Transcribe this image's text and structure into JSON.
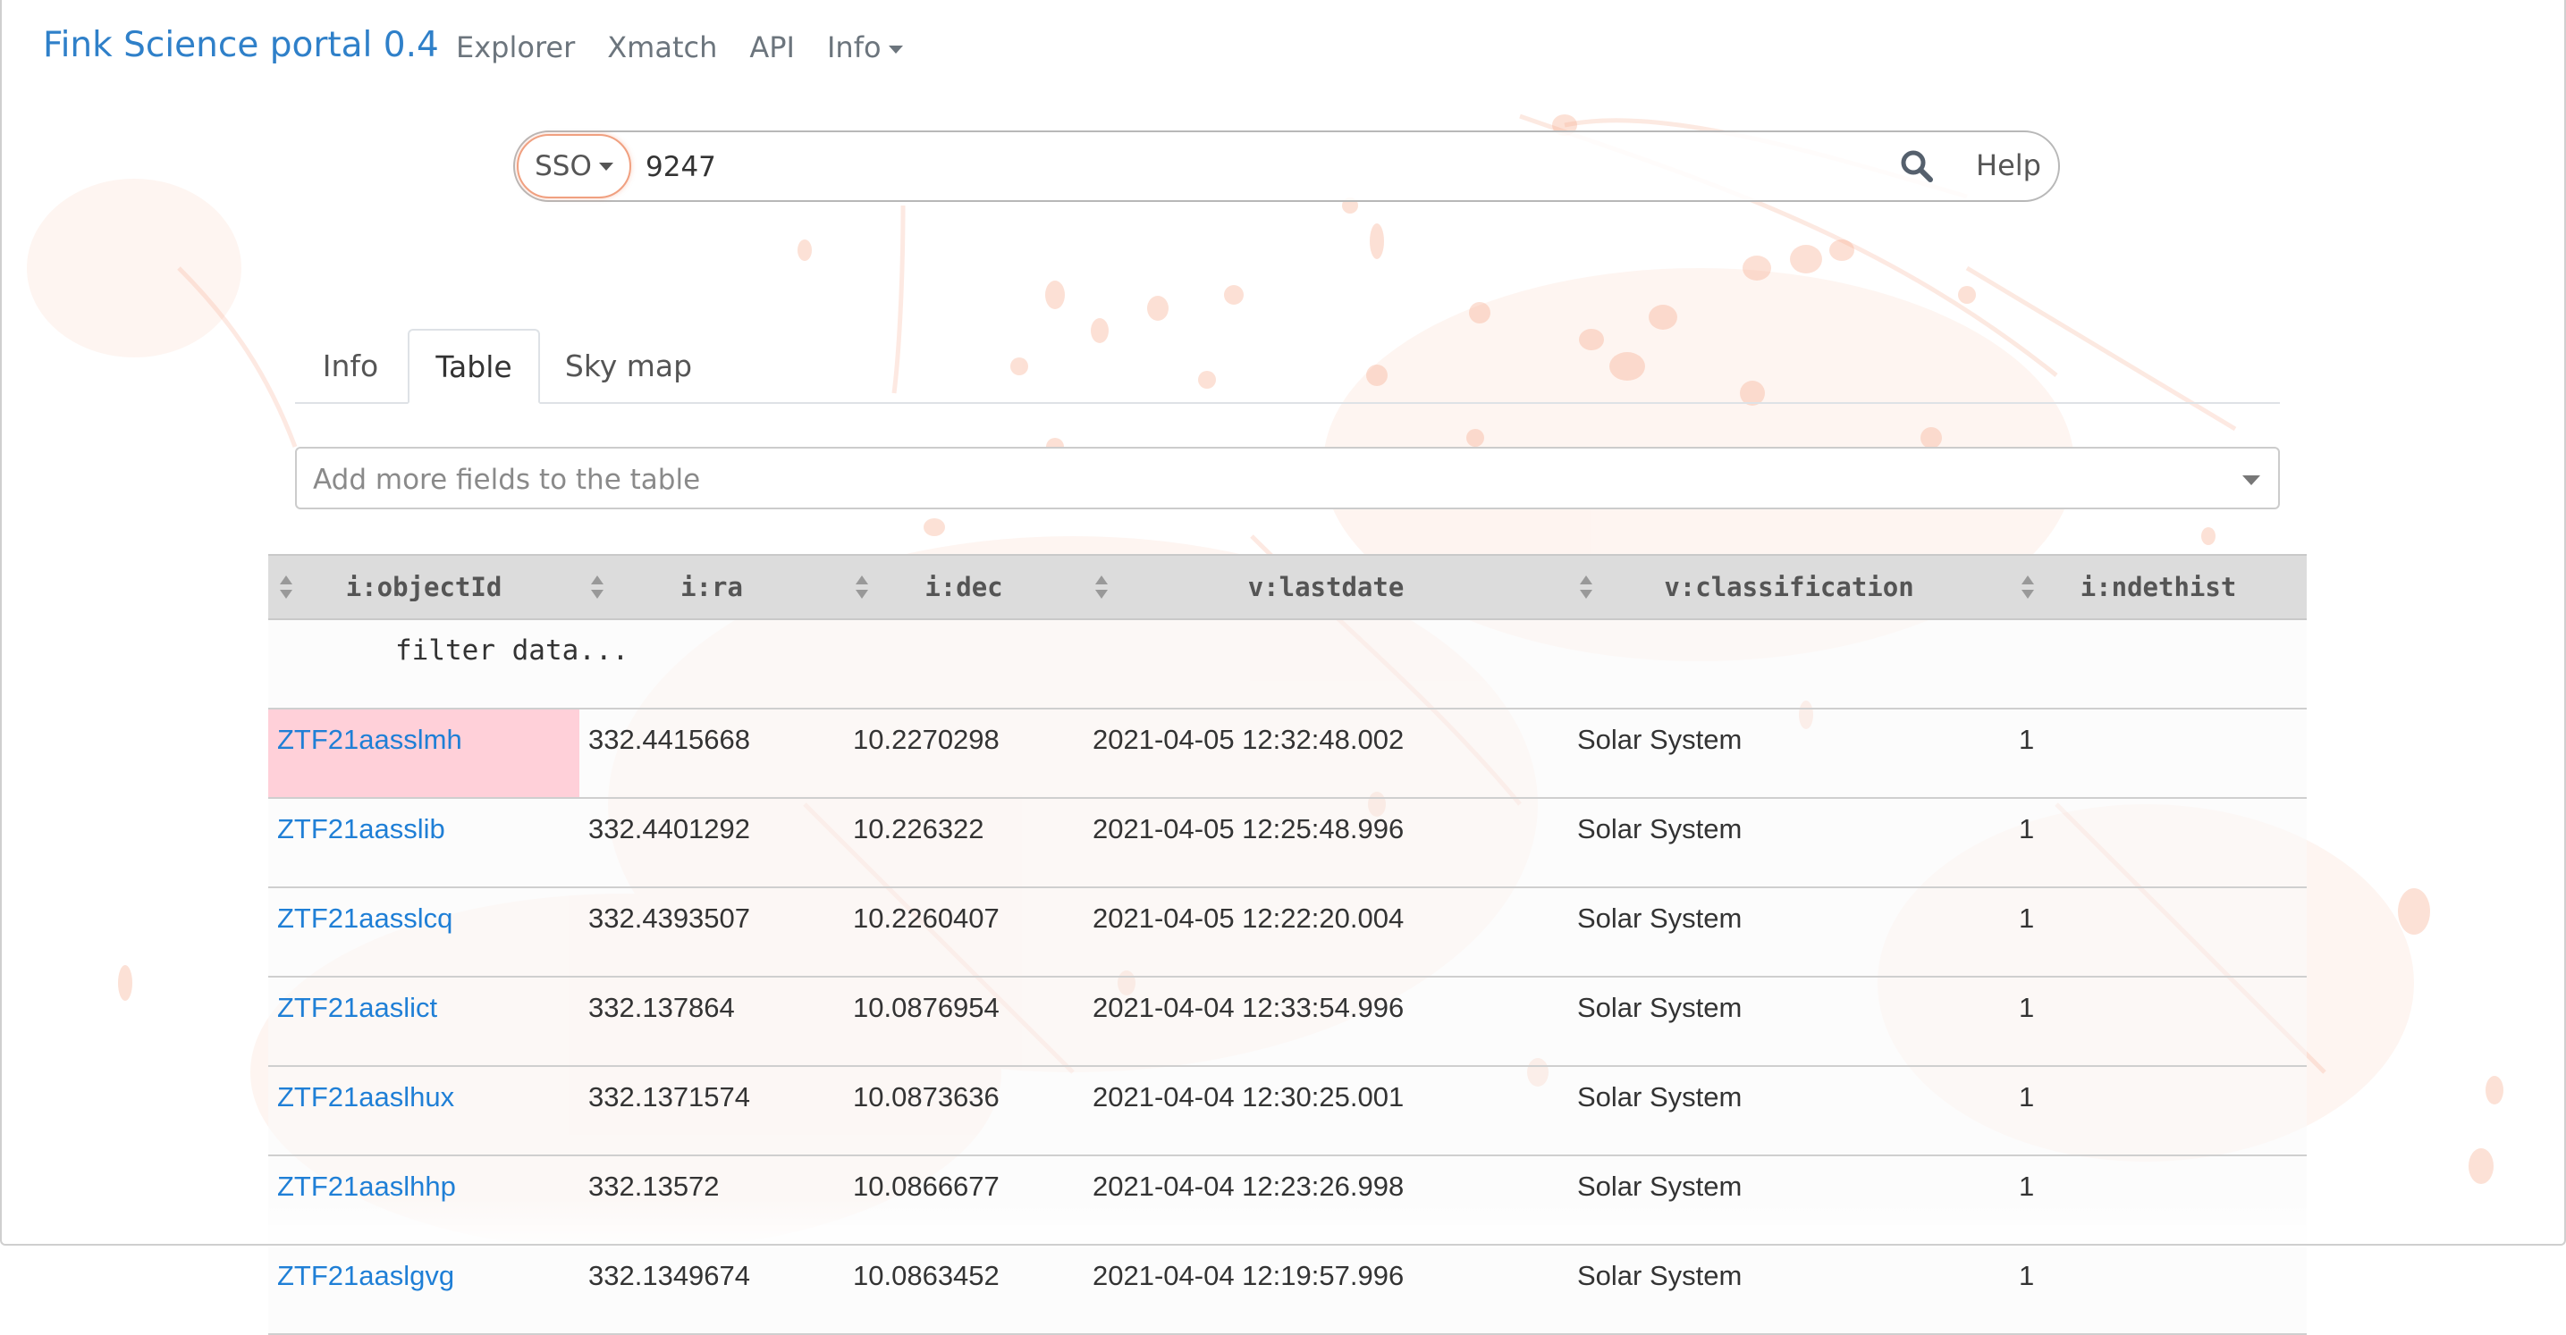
{
  "navbar": {
    "brand": "Fink Science portal 0.4",
    "links": [
      {
        "label": "Explorer"
      },
      {
        "label": "Xmatch"
      },
      {
        "label": "API"
      },
      {
        "label": "Info"
      }
    ]
  },
  "search": {
    "mode": "SSO",
    "value": "9247",
    "help_label": "Help"
  },
  "tabs": [
    {
      "label": "Info",
      "active": false
    },
    {
      "label": "Table",
      "active": true
    },
    {
      "label": "Sky map",
      "active": false
    }
  ],
  "field_select": {
    "placeholder": "Add more fields to the table"
  },
  "table": {
    "columns": [
      "i:objectId",
      "i:ra",
      "i:dec",
      "v:lastdate",
      "v:classification",
      "i:ndethist"
    ],
    "filter_placeholder": "filter data...",
    "rows": [
      [
        "ZTF21aasslmh",
        "332.4415668",
        "10.2270298",
        "2021-04-05 12:32:48.002",
        "Solar System",
        "1"
      ],
      [
        "ZTF21aasslib",
        "332.4401292",
        "10.226322",
        "2021-04-05 12:25:48.996",
        "Solar System",
        "1"
      ],
      [
        "ZTF21aasslcq",
        "332.4393507",
        "10.2260407",
        "2021-04-05 12:22:20.004",
        "Solar System",
        "1"
      ],
      [
        "ZTF21aaslict",
        "332.137864",
        "10.0876954",
        "2021-04-04 12:33:54.996",
        "Solar System",
        "1"
      ],
      [
        "ZTF21aaslhux",
        "332.1371574",
        "10.0873636",
        "2021-04-04 12:30:25.001",
        "Solar System",
        "1"
      ],
      [
        "ZTF21aaslhhp",
        "332.13572",
        "10.0866677",
        "2021-04-04 12:23:26.998",
        "Solar System",
        "1"
      ],
      [
        "ZTF21aaslgvg",
        "332.1349674",
        "10.0863452",
        "2021-04-04 12:19:57.996",
        "Solar System",
        "1"
      ]
    ]
  },
  "colors": {
    "brand": "#2f80c9",
    "link": "#1f7fd6",
    "accent": "#f0a080",
    "selected_cell": "#ffb3c1"
  },
  "icons": {
    "search": "search-icon",
    "sort": "sort-icon"
  }
}
